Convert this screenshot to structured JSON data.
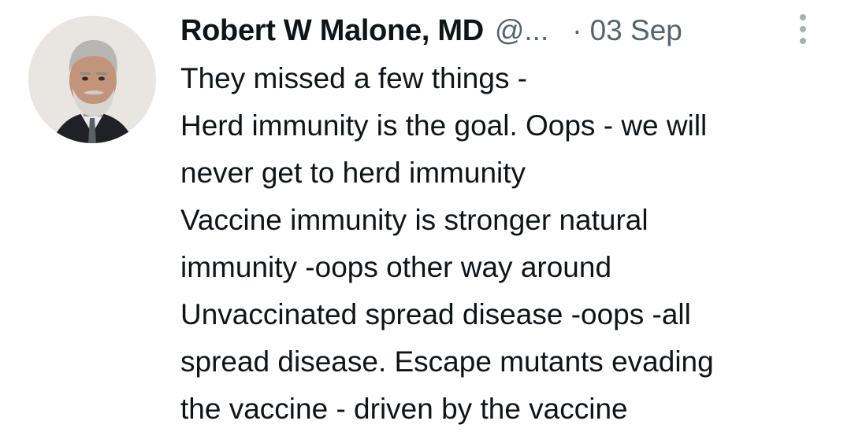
{
  "tweet": {
    "author": {
      "name": "Robert W Malone, MD",
      "handle": "@...",
      "avatar_icon": "profile-photo"
    },
    "separator": "·",
    "date": "03 Sep",
    "more_icon": "vertical-ellipsis-icon",
    "lines": [
      "They missed a few things -",
      "Herd immunity is the goal. Oops - we will",
      "never get to herd immunity",
      "Vaccine immunity is stronger natural",
      "immunity -oops other way around",
      "Unvaccinated spread disease -oops -all",
      "spread disease. Escape mutants evading",
      "the vaccine - driven by the vaccine"
    ]
  },
  "colors": {
    "text_primary": "#0f1419",
    "text_secondary": "#536471",
    "icon_muted": "#a6afb6",
    "background": "#ffffff"
  }
}
